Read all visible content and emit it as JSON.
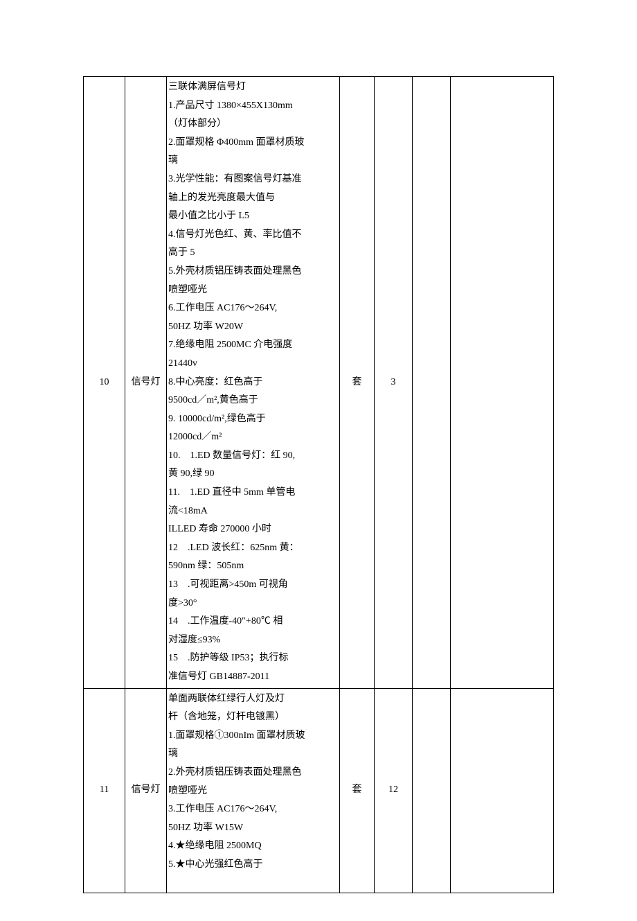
{
  "rows": [
    {
      "index": "10",
      "name": "信号灯",
      "unit": "套",
      "qty": "3",
      "spec_lines": [
        "三联体满屏信号灯",
        "1.产品尺寸 1380×455X130mm",
        "（灯体部分）",
        "2.面罩规格 Φ400mm 面罩材质玻",
        "璃",
        "3.光学性能：有图案信号灯基准",
        "轴上的发光亮度最大值与",
        "最小值之比小于 L5",
        "4.信号灯光色红、黄、率比值不",
        "高于 5",
        "5.外壳材质铝压铸表面处理黑色",
        "喷塑哑光",
        "6.工作电压 AC176～264V,",
        "50HZ 功率 W20W",
        "7.绝缘电阻 2500MC 介电强度",
        "21440v",
        "8.中心亮度：红色高于",
        "9500cd／m²,黄色高于",
        "9. 10000cd/m²,绿色高于",
        "12000cd／m²",
        "10.    1.ED 数量信号灯：红 90,",
        "黄 90,绿 90",
        "11.    1.ED 直径中 5mm 单管电",
        "流<18mA",
        "ILLED 寿命 270000 小时",
        "12    .LED 波长红：625nm 黄：",
        "590nm 绿：505nm",
        "13    .可视距离>450m 可视角",
        "度>30°",
        "14    .工作温度-40″+80℃ 相",
        "对湿度≤93%",
        "15    .防护等级 IP53；执行标",
        "准信号灯 GB14887-2011"
      ]
    },
    {
      "index": "11",
      "name": "信号灯",
      "unit": "套",
      "qty": "12",
      "spec_lines": [
        "单面两联体红绿行人灯及灯",
        "杆（含地笼，灯杆电镀黑）",
        "1.面罩规格①300nIm 面罩材质玻",
        "璃",
        "2.外壳材质铝压铸表面处理黑色",
        "喷塑哑光",
        "3.工作电压 AC176～264V,",
        "50HZ 功率 W15W",
        "4.★绝缘电阻 2500MQ",
        "5.★中心光强红色高于"
      ]
    }
  ]
}
